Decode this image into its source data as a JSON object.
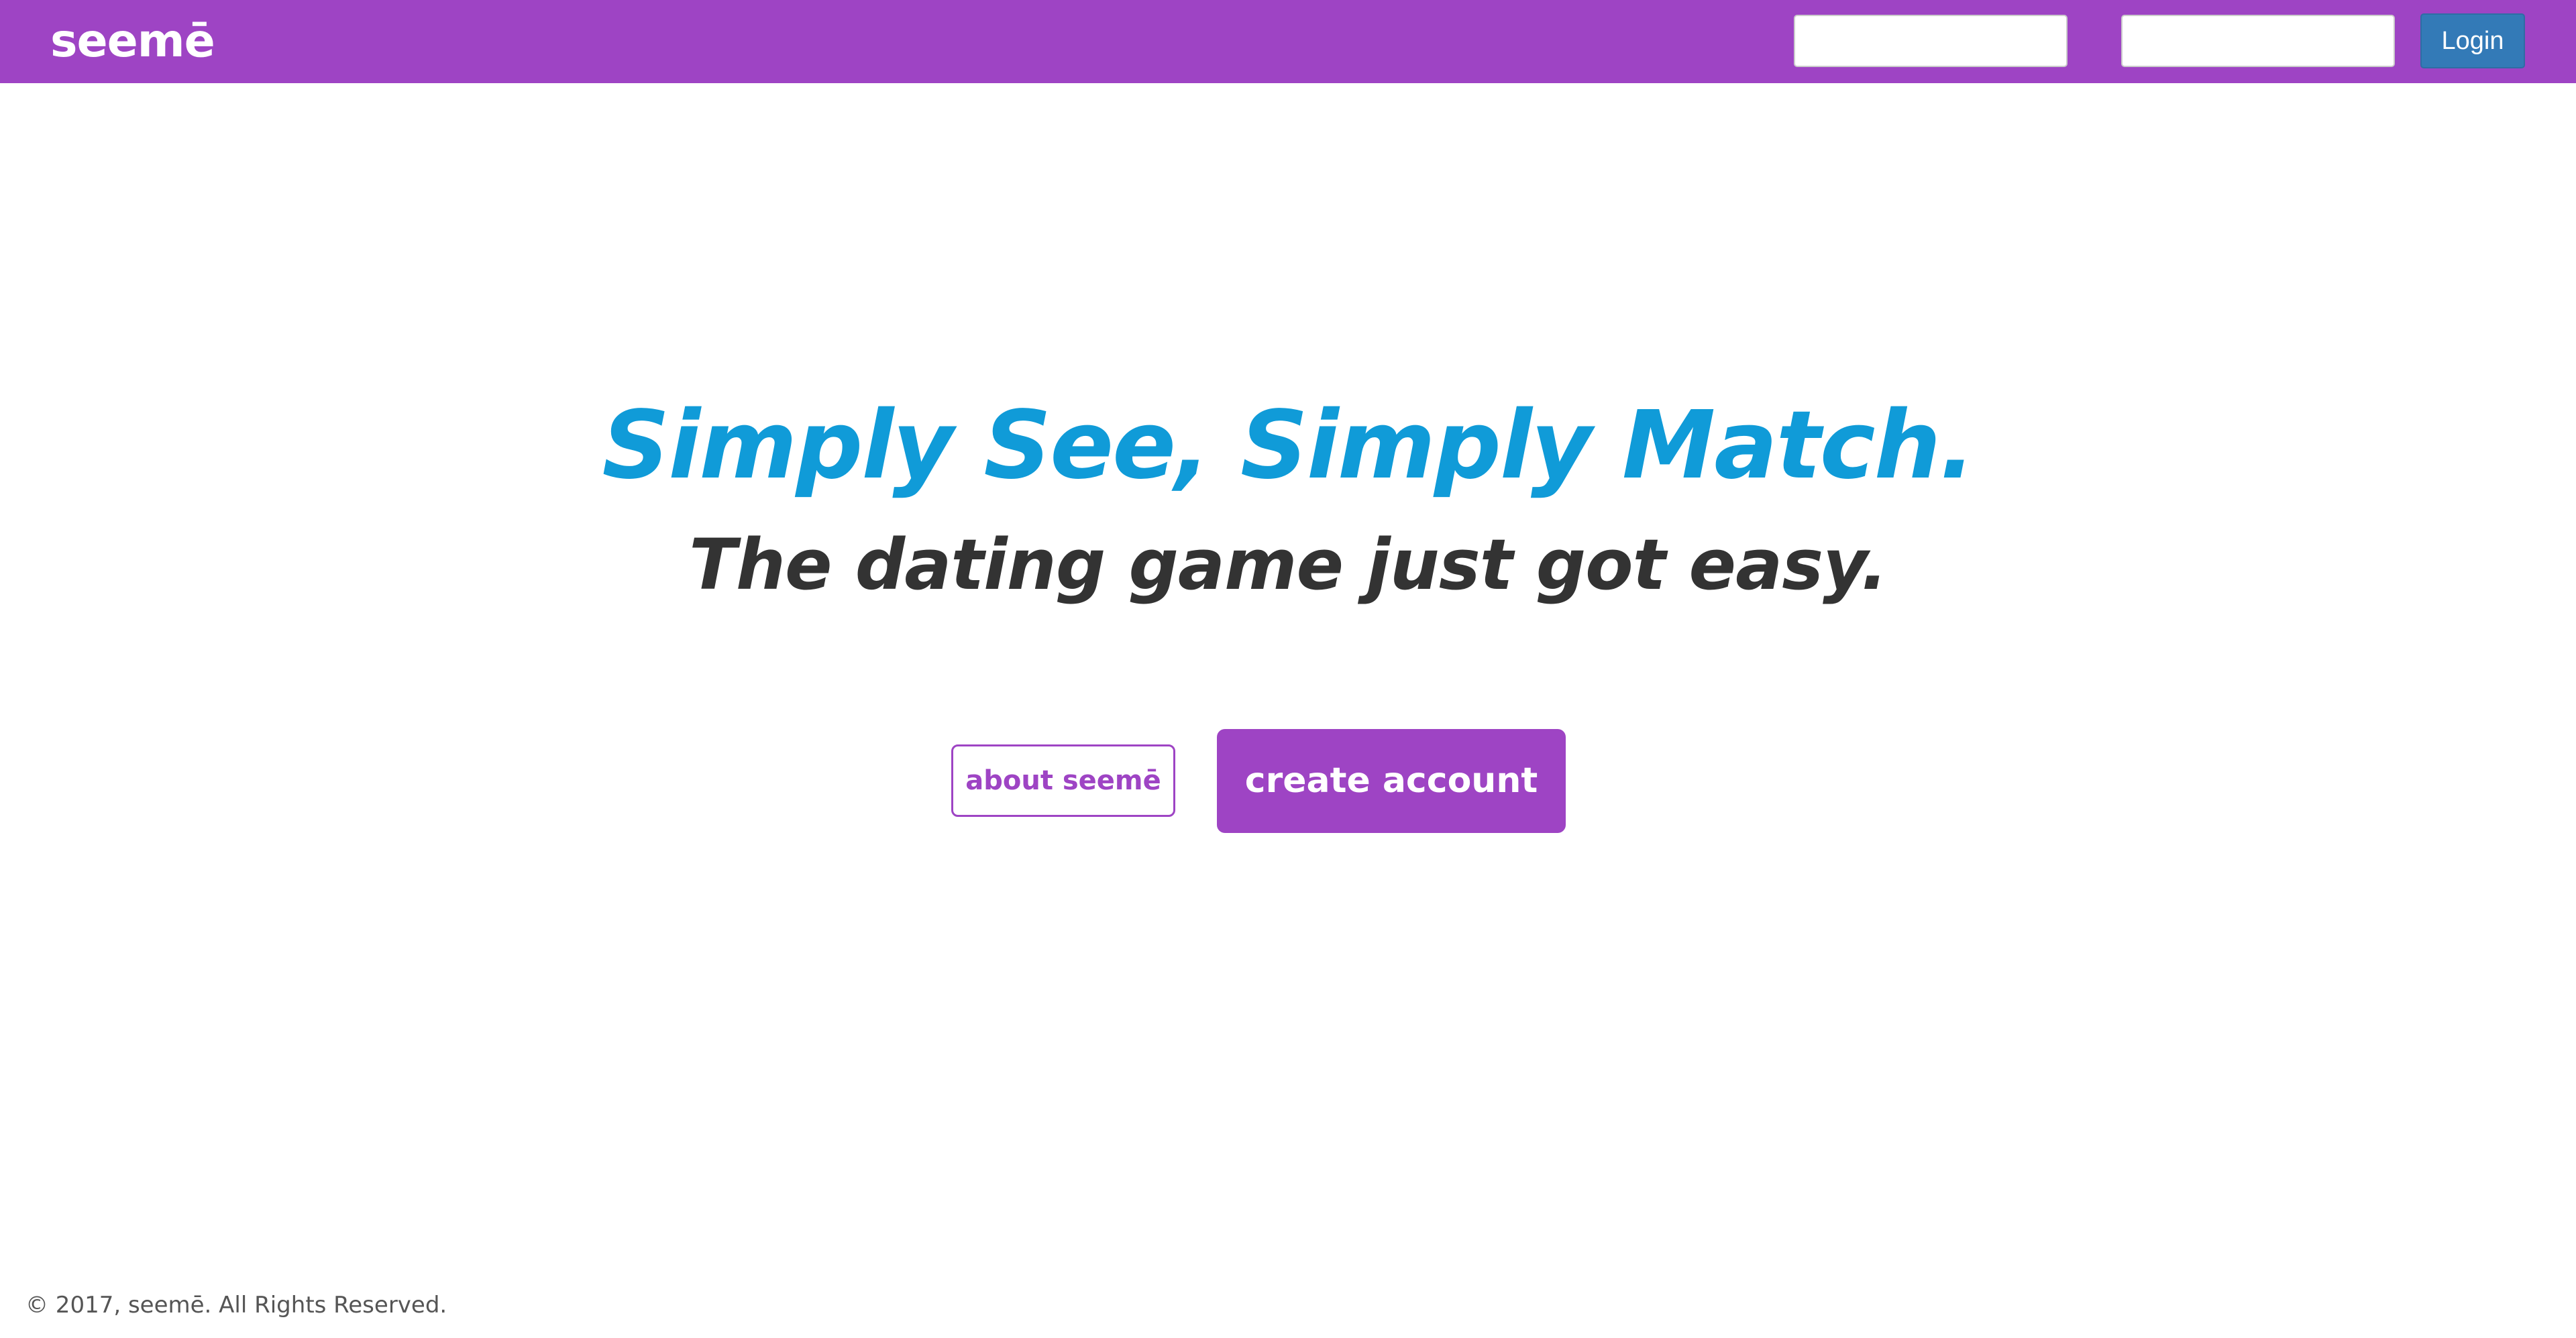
{
  "navbar": {
    "brand": "seemē",
    "username_value": "",
    "password_value": "",
    "login_label": "Login"
  },
  "hero": {
    "title": "Simply See, Simply Match.",
    "subtitle": "The dating game just got easy."
  },
  "actions": {
    "about_label": "about seemē",
    "create_label": "create account"
  },
  "footer": {
    "copyright": "© 2017, seemē. All Rights Reserved."
  },
  "colors": {
    "brand_purple": "#9e44c4",
    "title_blue": "#109bd8",
    "login_blue": "#337ab7",
    "subtitle_gray": "#333333"
  }
}
